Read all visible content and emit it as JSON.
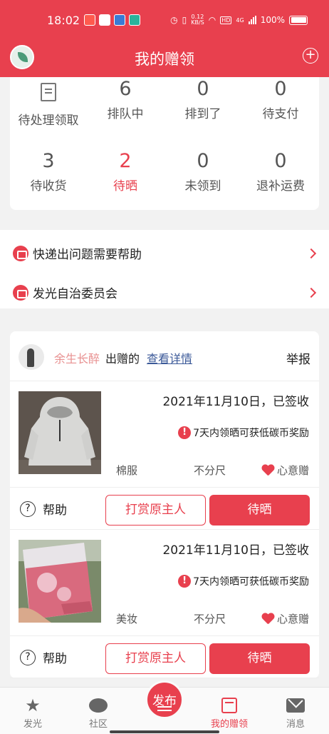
{
  "status_bar": {
    "time": "18:02",
    "speed_value": "0.12",
    "speed_unit": "KB/S",
    "network": "4G",
    "battery": "100%"
  },
  "header": {
    "title": "我的赠领"
  },
  "stats": [
    {
      "count": "",
      "label": "待处理领取",
      "icon": "document-icon",
      "highlight": false
    },
    {
      "count": "6",
      "label": "排队中",
      "highlight": false
    },
    {
      "count": "0",
      "label": "排到了",
      "highlight": false
    },
    {
      "count": "0",
      "label": "待支付",
      "highlight": false
    },
    {
      "count": "3",
      "label": "待收货",
      "highlight": false
    },
    {
      "count": "2",
      "label": "待晒",
      "highlight": true
    },
    {
      "count": "0",
      "label": "未领到",
      "highlight": false
    },
    {
      "count": "0",
      "label": "退补运费",
      "highlight": false
    }
  ],
  "help_links": [
    {
      "label": "快递出问题需要帮助",
      "icon": "printer-icon"
    },
    {
      "label": "发光自治委员会",
      "icon": "printer-icon"
    }
  ],
  "gift": {
    "owner_name": "余生长醉",
    "owner_suffix": "出赠的",
    "detail_link": "查看详情",
    "report": "举报",
    "items": [
      {
        "date": "2021年11月10日，已签收",
        "notice": "7天内领晒可获低碳币奖励",
        "category": "棉服",
        "size": "不分尺",
        "mode": "心意赠",
        "help": "帮助",
        "tip_button": "打赏原主人",
        "post_button": "待晒"
      },
      {
        "date": "2021年11月10日，已签收",
        "notice": "7天内领晒可获低碳币奖励",
        "category": "美妆",
        "size": "不分尺",
        "mode": "心意赠",
        "help": "帮助",
        "tip_button": "打赏原主人",
        "post_button": "待晒"
      }
    ]
  },
  "nav": {
    "tabs": [
      {
        "label": "发光",
        "icon": "star-icon"
      },
      {
        "label": "社区",
        "icon": "chat-icon"
      },
      {
        "label": "我的赠领",
        "icon": "box-icon",
        "active": true
      },
      {
        "label": "消息",
        "icon": "mail-icon"
      }
    ],
    "publish": "发布"
  },
  "colors": {
    "brand": "#e8404e",
    "owner_name": "#e89090",
    "link": "#3c5a99"
  }
}
